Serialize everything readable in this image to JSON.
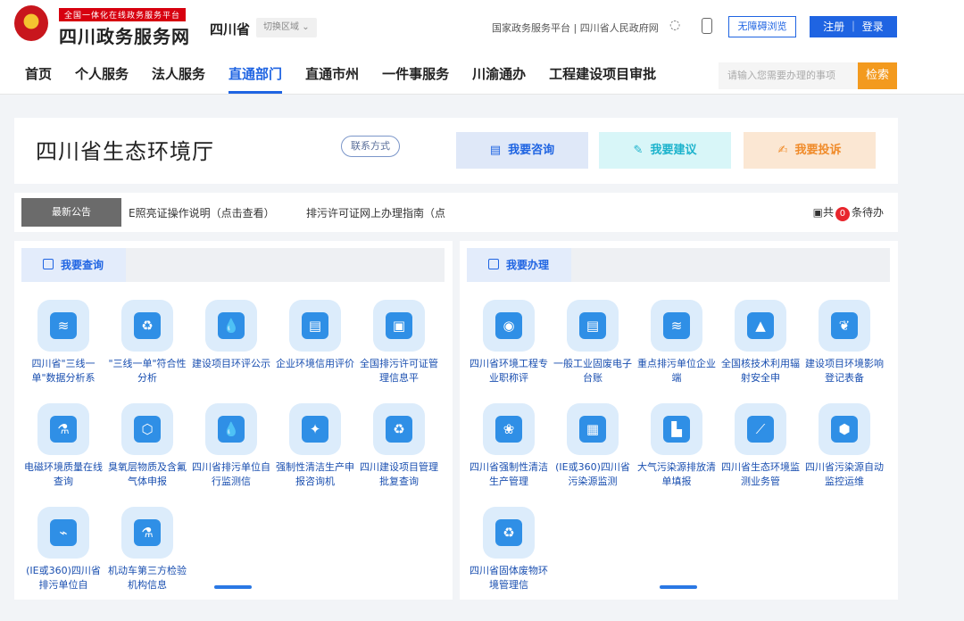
{
  "header": {
    "brand_subtitle": "全国一体化在线政务服务平台",
    "brand_name": "四川政务服务网",
    "province": "四川省",
    "switch_area": "切换区域",
    "top_links": "国家政务服务平台 | 四川省人民政府网",
    "accessibility": "无障碍浏览",
    "auth": "注册 ｜ 登录",
    "search_placeholder": "请输入您需要办理的事项",
    "search_button": "检索"
  },
  "nav": {
    "items": [
      "首页",
      "个人服务",
      "法人服务",
      "直通部门",
      "直通市州",
      "一件事服务",
      "川渝通办",
      "工程建设项目审批"
    ],
    "active_index": 3
  },
  "dept": {
    "title": "四川省生态环境厅",
    "contact": "联系方式",
    "consult": "我要咨询",
    "suggest": "我要建议",
    "complain": "我要投诉"
  },
  "notice": {
    "tag": "最新公告",
    "items": [
      "E照亮证操作说明（点击查看）",
      "排污许可证网上办理指南（点"
    ],
    "todo_prefix": "共",
    "todo_count": "0",
    "todo_suffix": "条待办"
  },
  "query_panel": {
    "title": "我要查询",
    "items": [
      {
        "label": "四川省\"三线一单\"数据分析系",
        "icon": "chart-screen-icon"
      },
      {
        "label": "\"三线一单\"符合性分析",
        "icon": "recycle-battery-icon"
      },
      {
        "label": "建设项目环评公示",
        "icon": "water-hand-icon"
      },
      {
        "label": "企业环境信用评价",
        "icon": "credit-document-icon"
      },
      {
        "label": "全国排污许可证管理信息平",
        "icon": "screen-icon"
      },
      {
        "label": "电磁环境质量在线查询",
        "icon": "flask-icon"
      },
      {
        "label": "臭氧层物质及含氟气体申报",
        "icon": "molecule-icon"
      },
      {
        "label": "四川省排污单位自行监测信",
        "icon": "water-drop-icon"
      },
      {
        "label": "强制性清洁生产申报咨询机",
        "icon": "bulb-icon"
      },
      {
        "label": "四川建设项目管理批复查询",
        "icon": "recycle-icon"
      },
      {
        "label": "(IE或360)四川省排污单位自",
        "icon": "pollution-pipe-icon"
      },
      {
        "label": "机动车第三方检验机构信息",
        "icon": "flask-icon"
      }
    ]
  },
  "handle_panel": {
    "title": "我要办理",
    "items": [
      {
        "label": "四川省环境工程专业职称评",
        "icon": "globe-icon"
      },
      {
        "label": "一般工业固废电子台账",
        "icon": "document-icon"
      },
      {
        "label": "重点排污单位企业端",
        "icon": "chart-screen-icon"
      },
      {
        "label": "全国核技术利用辐射安全申",
        "icon": "cooling-tower-icon"
      },
      {
        "label": "建设项目环境影响登记表备",
        "icon": "leaf-icon"
      },
      {
        "label": "四川省强制性清洁生产管理",
        "icon": "leaf-circle-icon"
      },
      {
        "label": "(IE或360)四川省污染源监测",
        "icon": "solar-panel-icon"
      },
      {
        "label": "大气污染源排放清单填报",
        "icon": "factory-icon"
      },
      {
        "label": "四川省生态环境监测业务管",
        "icon": "test-tube-icon"
      },
      {
        "label": "四川省污染源自动监控运维",
        "icon": "location-leaf-icon"
      },
      {
        "label": "四川省固体废物环境管理信",
        "icon": "recycle-bin-icon"
      }
    ]
  }
}
